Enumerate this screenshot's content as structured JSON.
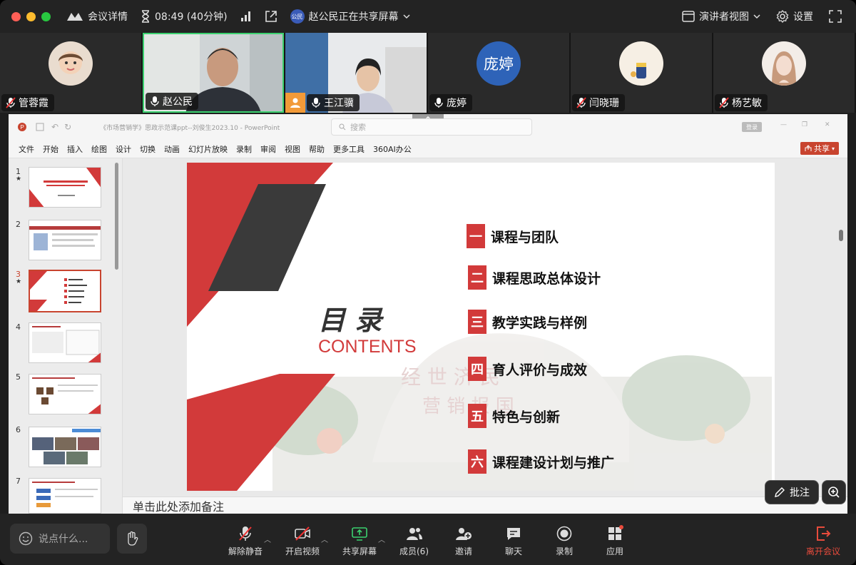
{
  "titlebar": {
    "app_title": "会议详情",
    "timer": "08:49 (40分钟)",
    "share_badge": "公民",
    "share_status": "赵公民正在共享屏幕",
    "presenter_view": "演讲者视图",
    "settings": "设置"
  },
  "participants": [
    {
      "name": "管蓉霞",
      "muted": true
    },
    {
      "name": "赵公民",
      "muted": false,
      "active": true
    },
    {
      "name": "王江骥",
      "muted": false
    },
    {
      "name": "庞婷",
      "muted": false,
      "avatar_text": "庞婷"
    },
    {
      "name": "闫晓珊",
      "muted": true
    },
    {
      "name": "杨艺敏",
      "muted": true
    }
  ],
  "ppt": {
    "doc_title": "《市场营销学》思政示范课ppt--刘俊生2023.10 - PowerPoint",
    "search_placeholder": "搜索",
    "login": "登录",
    "share": "共享",
    "menu": [
      "文件",
      "开始",
      "插入",
      "绘图",
      "设计",
      "切换",
      "动画",
      "幻灯片放映",
      "录制",
      "审阅",
      "视图",
      "帮助",
      "更多工具",
      "360AI办公"
    ],
    "thumbnails": [
      "1",
      "2",
      "3",
      "4",
      "5",
      "6",
      "7"
    ],
    "selected_slide": "3",
    "notes_placeholder": "单击此处添加备注"
  },
  "slide": {
    "title_cn": "目 录",
    "title_en": "CONTENTS",
    "items": [
      {
        "num": "一",
        "text": "课程与团队"
      },
      {
        "num": "二",
        "text": "课程思政总体设计"
      },
      {
        "num": "三",
        "text": "教学实践与样例"
      },
      {
        "num": "四",
        "text": "育人评价与成效"
      },
      {
        "num": "五",
        "text": "特色与创新"
      },
      {
        "num": "六",
        "text": "课程建设计划与推广"
      }
    ],
    "accent": "#d23a3a"
  },
  "floating": {
    "annotate": "批注"
  },
  "controls": {
    "chat_placeholder": "说点什么...",
    "unmute": "解除静音",
    "start_video": "开启视频",
    "share_screen": "共享屏幕",
    "members": "成员(6)",
    "invite": "邀请",
    "chat": "聊天",
    "record": "录制",
    "apps": "应用",
    "leave": "离开会议"
  }
}
